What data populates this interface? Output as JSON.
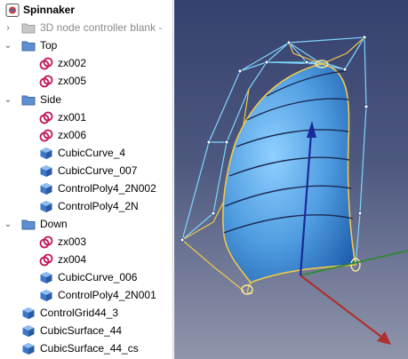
{
  "tree": {
    "items": [
      {
        "label": "Spinnaker",
        "kind": "doc"
      },
      {
        "label": "3D node controller blank -",
        "kind": "folder-grey"
      },
      {
        "label": "Top",
        "kind": "folder"
      },
      {
        "label": "zx002",
        "kind": "link"
      },
      {
        "label": "zx005",
        "kind": "link"
      },
      {
        "label": "Side",
        "kind": "folder"
      },
      {
        "label": "zx001",
        "kind": "link"
      },
      {
        "label": "zx006",
        "kind": "link"
      },
      {
        "label": "CubicCurve_4",
        "kind": "cube"
      },
      {
        "label": "CubicCurve_007",
        "kind": "cube"
      },
      {
        "label": "ControlPoly4_2N002",
        "kind": "cube"
      },
      {
        "label": "ControlPoly4_2N",
        "kind": "cube"
      },
      {
        "label": "Down",
        "kind": "folder"
      },
      {
        "label": "zx003",
        "kind": "link"
      },
      {
        "label": "zx004",
        "kind": "link"
      },
      {
        "label": "CubicCurve_006",
        "kind": "cube"
      },
      {
        "label": "ControlPoly4_2N001",
        "kind": "cube"
      },
      {
        "label": "ControlGrid44_3",
        "kind": "cube"
      },
      {
        "label": "CubicSurface_44",
        "kind": "cube"
      },
      {
        "label": "CubicSurface_44_cs",
        "kind": "cube"
      }
    ]
  },
  "viewport": {
    "colors": {
      "surface": "#4f9ce0",
      "control_net": "#7fd6ff",
      "edge": "#f0c84a",
      "axis_x": "#b03030",
      "axis_y": "#2a8a2a",
      "axis_z": "#1a2a9a"
    }
  }
}
